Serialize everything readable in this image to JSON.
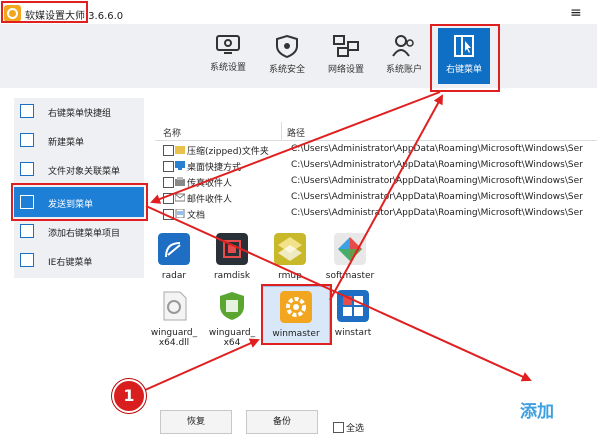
{
  "app": {
    "title": "软媒设置大师 3.6.6.0",
    "menu_icon": "≡"
  },
  "topnav": [
    {
      "label": "系统设置",
      "icon": "system-settings-icon"
    },
    {
      "label": "系统安全",
      "icon": "shield-icon"
    },
    {
      "label": "网络设置",
      "icon": "network-icon"
    },
    {
      "label": "系统账户",
      "icon": "users-icon"
    },
    {
      "label": "右键菜单",
      "icon": "right-click-menu-icon",
      "active": true
    }
  ],
  "sidebar": [
    {
      "label": "右键菜单快捷组"
    },
    {
      "label": "新建菜单"
    },
    {
      "label": "文件对象关联菜单"
    },
    {
      "label": "发送到菜单",
      "active": true
    },
    {
      "label": "添加右键菜单项目"
    },
    {
      "label": "IE右键菜单"
    }
  ],
  "list": {
    "columns": [
      "名称",
      "路径"
    ],
    "rows": [
      {
        "name": "压缩(zipped)文件夹",
        "path": "C:\\Users\\Administrator\\AppData\\Roaming\\Microsoft\\Windows\\Ser"
      },
      {
        "name": "桌面快捷方式",
        "path": "C:\\Users\\Administrator\\AppData\\Roaming\\Microsoft\\Windows\\Ser"
      },
      {
        "name": "传真收件人",
        "path": "C:\\Users\\Administrator\\AppData\\Roaming\\Microsoft\\Windows\\Ser"
      },
      {
        "name": "邮件收件人",
        "path": "C:\\Users\\Administrator\\AppData\\Roaming\\Microsoft\\Windows\\Ser"
      },
      {
        "name": "文档",
        "path": "C:\\Users\\Administrator\\AppData\\Roaming\\Microsoft\\Windows\\Ser"
      }
    ]
  },
  "tiles": [
    {
      "label": "radar"
    },
    {
      "label": "ramdisk"
    },
    {
      "label": "rmup"
    },
    {
      "label": "softmaster"
    },
    {
      "label": "winguard_\nx64.dll"
    },
    {
      "label": "winguard_\nx64"
    },
    {
      "label": "winmaster",
      "selected": true
    },
    {
      "label": "winstart"
    }
  ],
  "footer": {
    "restore_label": "恢复",
    "backup_label": "备份",
    "select_all_label": "全选",
    "add_label": "添加"
  },
  "annotation": {
    "step_number": "1"
  },
  "colors": {
    "accent": "#1e7fd6",
    "annotation_red": "#e02020"
  }
}
